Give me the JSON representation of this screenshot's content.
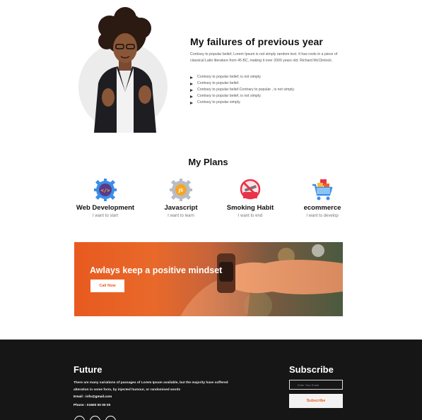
{
  "failures": {
    "title": "My failures of previous year",
    "description": "Contrary to popular belief, Lorem Ipsum is not simply random text. It has roots in a piece of classical Latin literature from 45 BC, making it over 2000 years old. Richard McClintock.",
    "items": [
      "Contrary to popular belief, is not simply.",
      "Contrary to popular belief.",
      "Contrary to popular belief.Contrary to popular , is not simply.",
      "Contrary to popular belief, is not simply.",
      "Contrary to popular simply."
    ]
  },
  "plans": {
    "title": "My Plans",
    "items": [
      {
        "name": "Web Development",
        "sub": "I want to start",
        "icon": "code-gear-icon"
      },
      {
        "name": "Javascript",
        "sub": "I want to learn",
        "icon": "js-gear-icon"
      },
      {
        "name": "Smoking Habit",
        "sub": "I want to end",
        "icon": "no-smoking-icon"
      },
      {
        "name": "ecommerce",
        "sub": "I want to develop",
        "icon": "shopping-cart-icon"
      }
    ]
  },
  "banner": {
    "title": "Awlays keep a positive mindset",
    "button": "Call Now"
  },
  "footer": {
    "title": "Future",
    "description": "There are many variations of passages of Lorem Ipsum available, but the majority have suffered alteration in some form, by injected humour, or randomised words",
    "email": "Email : info@gmail.com",
    "phone": "Phone : 01600 00 00 00",
    "subscribe": {
      "title": "Subscribe",
      "placeholder": "Enter Your Email",
      "button": "Subscribe"
    }
  },
  "colors": {
    "accent": "#e85a1f",
    "footer_bg": "#161616"
  }
}
